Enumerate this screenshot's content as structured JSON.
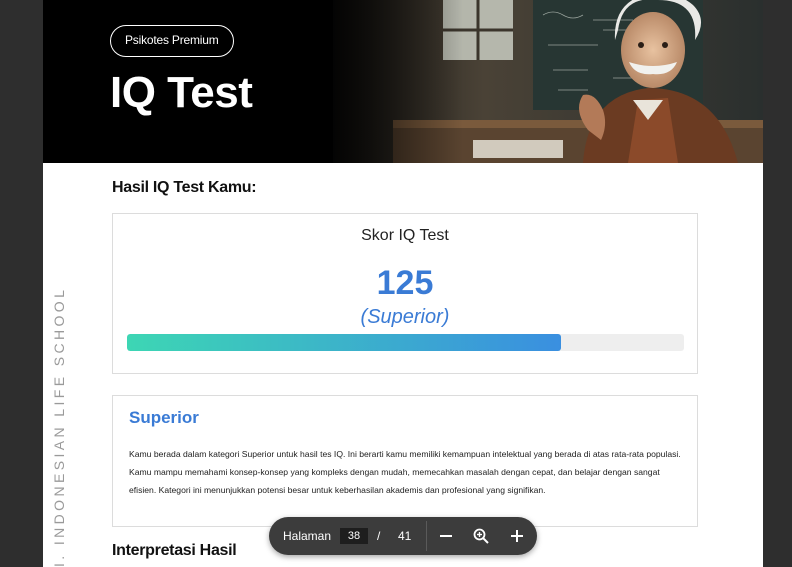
{
  "header": {
    "badge": "Psikotes Premium",
    "title": "IQ Test"
  },
  "side_text": "I. INDONESIAN LIFE SCHOOL",
  "result": {
    "section_title": "Hasil IQ Test Kamu:",
    "score_label": "Skor IQ Test",
    "score_value": "125",
    "category": "(Superior)",
    "progress_fraction": 0.78
  },
  "description": {
    "title": "Superior",
    "body": "Kamu berada dalam kategori Superior untuk hasil tes IQ. Ini berarti kamu memiliki kemampuan intelektual yang berada di atas rata-rata populasi. Kamu mampu memahami konsep-konsep yang kompleks dengan mudah, memecahkan masalah dengan cepat, dan belajar dengan sangat efisien. Kategori ini menunjukkan potensi besar untuk keberhasilan akademis dan profesional yang signifikan."
  },
  "next_section": "Interpretasi Hasil",
  "toolbar": {
    "label": "Halaman",
    "current_page": "38",
    "separator": "/",
    "total_pages": "41",
    "icons": [
      "minus-icon",
      "zoom-icon",
      "plus-icon"
    ]
  },
  "colors": {
    "accent": "#3a7bd5",
    "bar_start": "#3dd6b4",
    "bar_end": "#3a8fe0"
  }
}
